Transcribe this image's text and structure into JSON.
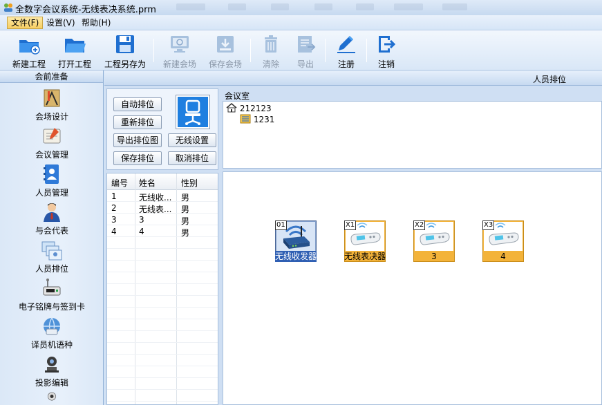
{
  "window": {
    "title": "全数字会议系统-无线表决系统.prm"
  },
  "menu": {
    "items": [
      {
        "label": "文件(F)",
        "active": true
      },
      {
        "label": "设置(V)",
        "active": false
      },
      {
        "label": "帮助(H)",
        "active": false
      }
    ]
  },
  "toolbar": {
    "new_project": "新建工程",
    "open_project": "打开工程",
    "save_as": "工程另存为",
    "new_venue": "新建会场",
    "save_venue": "保存会场",
    "clear": "清除",
    "export": "导出",
    "register": "注册",
    "logout": "注销"
  },
  "sidebar": {
    "header": "会前准备",
    "items": [
      {
        "label": "会场设计",
        "icon": "venue-design-icon"
      },
      {
        "label": "会议管理",
        "icon": "meeting-management-icon"
      },
      {
        "label": "人员管理",
        "icon": "personnel-management-icon"
      },
      {
        "label": "与会代表",
        "icon": "delegate-icon"
      },
      {
        "label": "人员排位",
        "icon": "seating-icon"
      },
      {
        "label": "电子铭牌与签到卡",
        "icon": "nameplate-icon"
      },
      {
        "label": "译员机语种",
        "icon": "interpreter-icon"
      },
      {
        "label": "投影编辑",
        "icon": "projection-icon"
      }
    ]
  },
  "section": {
    "title": "人员排位"
  },
  "controls": {
    "auto_seat": "自动排位",
    "reseat": "重新排位",
    "export_chart": "导出排位图",
    "save_seat": "保存排位",
    "wireless_settings": "无线设置",
    "cancel_seat": "取消排位"
  },
  "table": {
    "headers": [
      "编号",
      "姓名",
      "性别"
    ],
    "rows": [
      [
        "1",
        "无线收...",
        "男"
      ],
      [
        "2",
        "无线表...",
        "男"
      ],
      [
        "3",
        "3",
        "男"
      ],
      [
        "4",
        "4",
        "男"
      ]
    ]
  },
  "room": {
    "label": "会议室",
    "tree_root": "212123",
    "tree_child": "1231"
  },
  "devices": [
    {
      "tag": "01",
      "name": "无线收发器",
      "kind": "receiver"
    },
    {
      "tag": "X1",
      "name": "无线表决器",
      "kind": "voter"
    },
    {
      "tag": "X2",
      "name": "3",
      "kind": "voter"
    },
    {
      "tag": "X3",
      "name": "4",
      "kind": "voter"
    }
  ],
  "colors": {
    "accent": "#2f5fb3",
    "device_fill": "#f3b33a",
    "panel_bg": "#d7e6f7"
  }
}
